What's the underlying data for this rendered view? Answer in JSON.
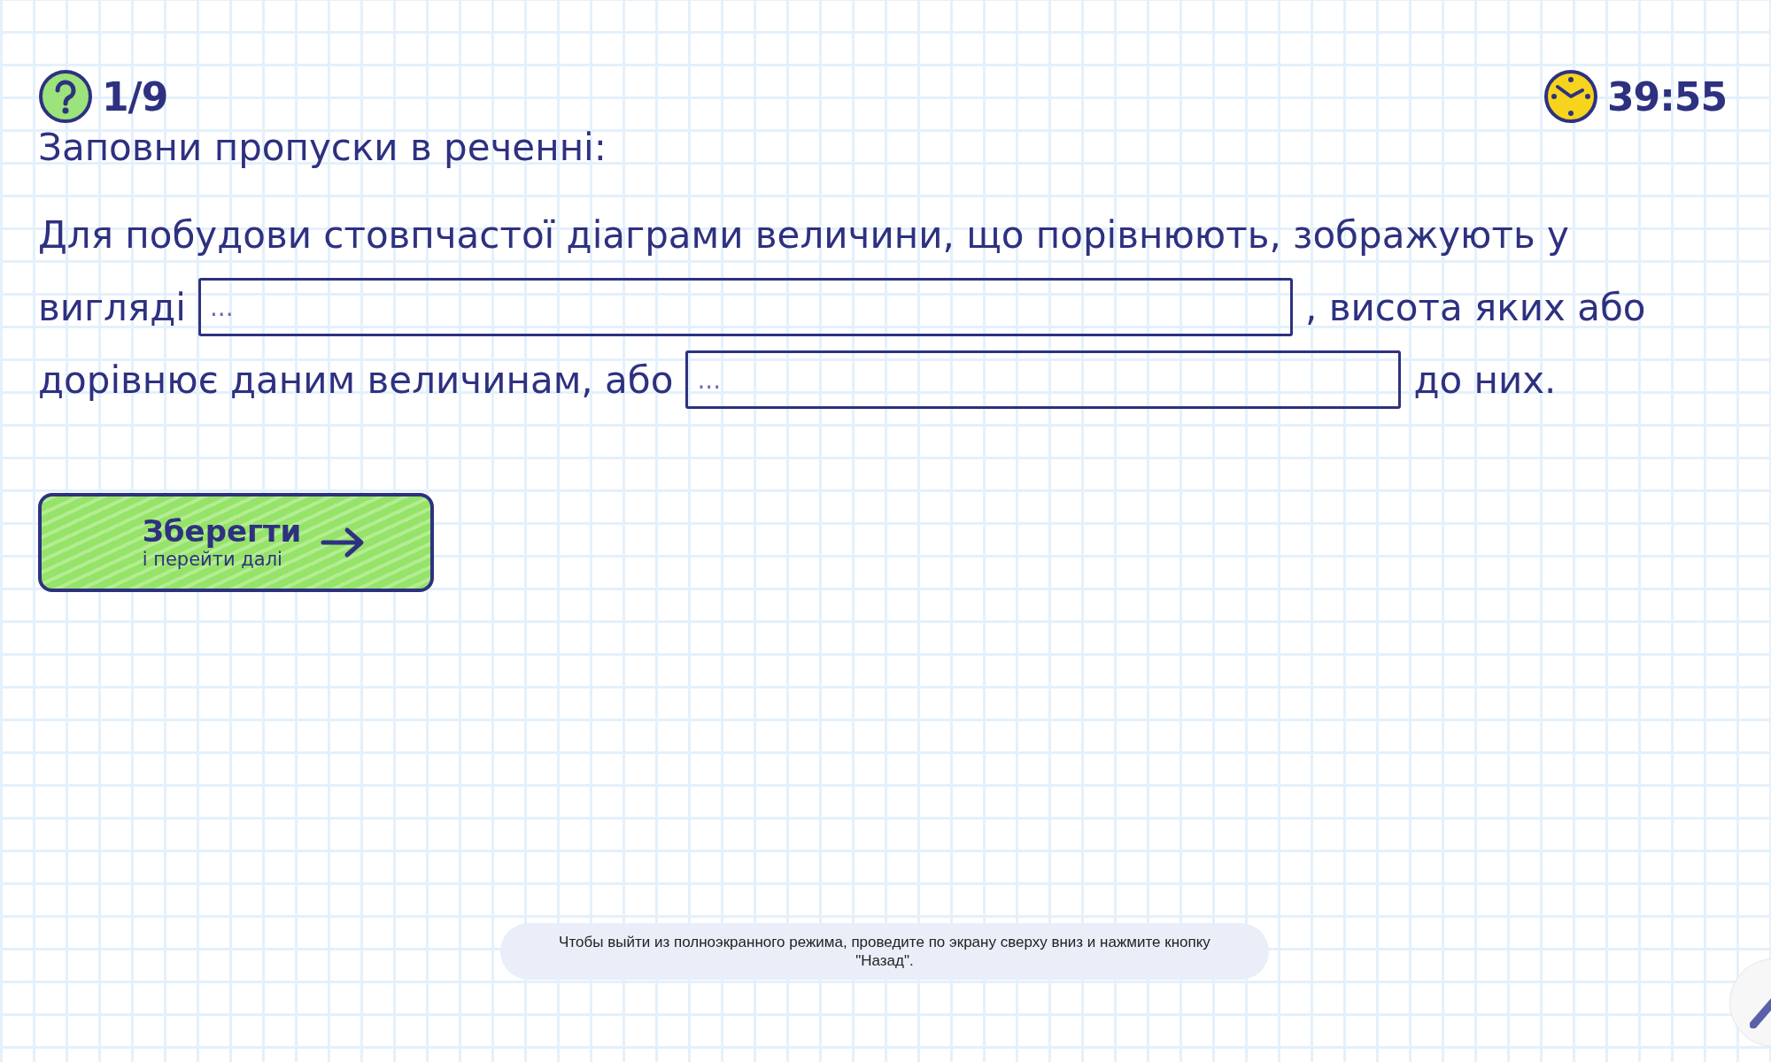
{
  "header": {
    "counter": "1/9",
    "timer": "39:55"
  },
  "instruction": "Заповни пропуски в реченні:",
  "sentence_lines": [
    [
      {
        "kind": "text",
        "text": "Для побудови стовпчастої діаграми величини, що порівнюють, зображують у"
      }
    ],
    [
      {
        "kind": "text",
        "text": "вигляді"
      },
      {
        "kind": "blank",
        "placeholder": "..."
      },
      {
        "kind": "text",
        "text": ", висота яких або"
      }
    ],
    [
      {
        "kind": "text",
        "text": "дорівнює даним величинам, або"
      },
      {
        "kind": "blank",
        "placeholder": "..."
      },
      {
        "kind": "text",
        "text": "до них."
      }
    ]
  ],
  "save_button": {
    "label": "Зберегти",
    "sublabel": "і перейти далі"
  },
  "toast": "Чтобы выйти из полноэкранного режима, проведите по экрану сверху вниз и нажмите кнопку \"Назад\"."
}
